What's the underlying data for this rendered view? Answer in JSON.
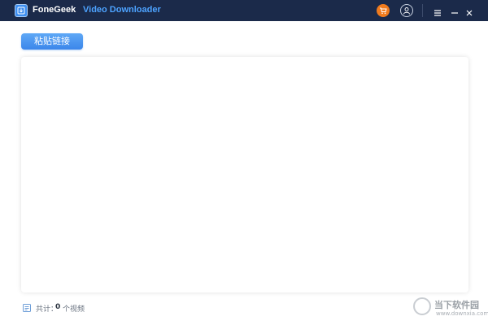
{
  "titlebar": {
    "app_name_part1": "FoneGeek",
    "app_name_part2": "Video Downloader",
    "bg_color": "#1b2a4a",
    "accent_color": "#4da3ff",
    "icons": [
      "app-logo-icon",
      "cart-icon",
      "user-icon",
      "menu-icon",
      "minimize-icon",
      "close-icon"
    ]
  },
  "toolbar": {
    "paste_label": "粘贴链接",
    "button_color": "#3b86ea"
  },
  "footer": {
    "total_label": "共计：",
    "count": "0",
    "unit": "个视频"
  },
  "watermark": {
    "text": "当下软件园",
    "url": "www.downxia.com"
  }
}
